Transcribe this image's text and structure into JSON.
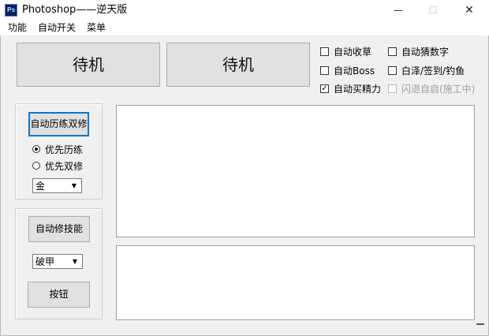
{
  "window": {
    "title": "Photoshop——逆天版",
    "app_icon_text": "Ps",
    "minimize_glyph": "—",
    "maximize_glyph": "☐",
    "close_glyph": "✕"
  },
  "menu": [
    "功能",
    "自动开关",
    "菜单"
  ],
  "status_buttons": [
    "待机",
    "待机"
  ],
  "checkboxes": [
    {
      "label": "自动收草",
      "checked": false,
      "disabled": false
    },
    {
      "label": "自动猜数字",
      "checked": false,
      "disabled": false
    },
    {
      "label": "自动Boss",
      "checked": false,
      "disabled": false
    },
    {
      "label": "白泽/签到/钓鱼",
      "checked": false,
      "disabled": false
    },
    {
      "label": "自动买精力",
      "checked": true,
      "disabled": false
    },
    {
      "label": "闪退自启(施工中)",
      "checked": false,
      "disabled": true
    }
  ],
  "panel1": {
    "button": "自动历练双修",
    "radios": [
      {
        "label": "优先历练",
        "selected": true
      },
      {
        "label": "优先双修",
        "selected": false
      }
    ],
    "select_value": "金"
  },
  "panel2": {
    "button": "自动修技能",
    "select_value": "破甲",
    "button2": "按钮"
  }
}
